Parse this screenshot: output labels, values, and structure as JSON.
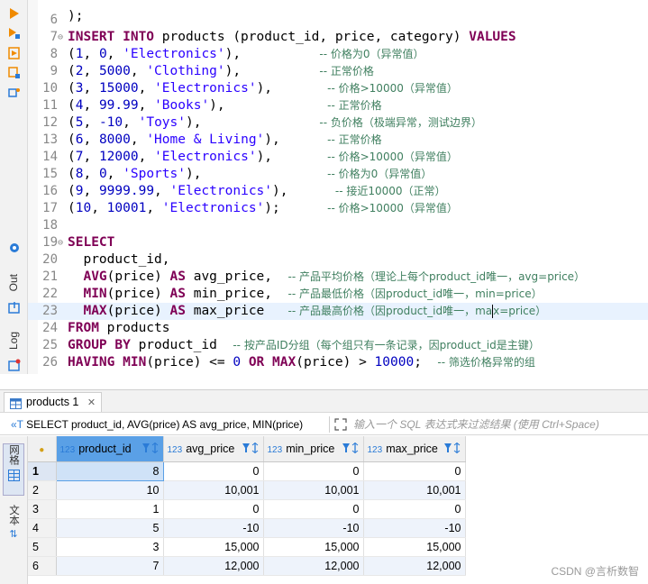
{
  "toolbar": {
    "panel_labels": [
      "Out",
      "Log"
    ]
  },
  "editor": {
    "top_partial_line": ");",
    "lines": [
      {
        "n": "6",
        "html": ""
      },
      {
        "n": "7",
        "fold": "⊖",
        "html": "<span class=\"kw\">INSERT INTO</span> products (product_id, price, category) <span class=\"kw\">VALUES</span>"
      },
      {
        "n": "8",
        "html": "(<span class=\"num\">1</span>, <span class=\"num\">0</span>, <span class=\"str\">'Electronics'</span>),          <span class=\"cmt\">-- 价格为0（异常值）</span>"
      },
      {
        "n": "9",
        "html": "(<span class=\"num\">2</span>, <span class=\"num\">5000</span>, <span class=\"str\">'Clothing'</span>),          <span class=\"cmt\">-- 正常价格</span>"
      },
      {
        "n": "10",
        "html": "(<span class=\"num\">3</span>, <span class=\"num\">15000</span>, <span class=\"str\">'Electronics'</span>),       <span class=\"cmt\">-- 价格&gt;10000（异常值）</span>"
      },
      {
        "n": "11",
        "html": "(<span class=\"num\">4</span>, <span class=\"num\">99.99</span>, <span class=\"str\">'Books'</span>),             <span class=\"cmt\">-- 正常价格</span>"
      },
      {
        "n": "12",
        "html": "(<span class=\"num\">5</span>, <span class=\"num\">-10</span>, <span class=\"str\">'Toys'</span>),               <span class=\"cmt\">-- 负价格（极端异常，测试边界）</span>"
      },
      {
        "n": "13",
        "html": "(<span class=\"num\">6</span>, <span class=\"num\">8000</span>, <span class=\"str\">'Home &amp; Living'</span>),      <span class=\"cmt\">-- 正常价格</span>"
      },
      {
        "n": "14",
        "html": "(<span class=\"num\">7</span>, <span class=\"num\">12000</span>, <span class=\"str\">'Electronics'</span>),       <span class=\"cmt\">-- 价格&gt;10000（异常值）</span>"
      },
      {
        "n": "15",
        "html": "(<span class=\"num\">8</span>, <span class=\"num\">0</span>, <span class=\"str\">'Sports'</span>),                <span class=\"cmt\">-- 价格为0（异常值）</span>"
      },
      {
        "n": "16",
        "html": "(<span class=\"num\">9</span>, <span class=\"num\">9999.99</span>, <span class=\"str\">'Electronics'</span>),      <span class=\"cmt\">-- 接近10000（正常）</span>"
      },
      {
        "n": "17",
        "html": "(<span class=\"num\">10</span>, <span class=\"num\">10001</span>, <span class=\"str\">'Electronics'</span>);      <span class=\"cmt\">-- 价格&gt;10000（异常值）</span>"
      },
      {
        "n": "18",
        "html": ""
      },
      {
        "n": "19",
        "fold": "⊖",
        "html": "<span class=\"kw\">SELECT</span>"
      },
      {
        "n": "20",
        "html": "  product_id,"
      },
      {
        "n": "21",
        "html": "  <span class=\"kw\">AVG</span>(price) <span class=\"kw\">AS</span> avg_price,  <span class=\"cmt\">-- 产品平均价格（理论上每个product_id唯一，avg=price）</span>"
      },
      {
        "n": "22",
        "html": "  <span class=\"kw\">MIN</span>(price) <span class=\"kw\">AS</span> min_price,  <span class=\"cmt\">-- 产品最低价格（因product_id唯一，min=price）</span>"
      },
      {
        "n": "23",
        "current": true,
        "html": "  <span class=\"kw\">MAX</span>(price) <span class=\"kw\">AS</span> max_price   <span class=\"cmt\">-- 产品最高价格（因product_id唯一，ma<span class=\"caret\"></span>x=price）</span>"
      },
      {
        "n": "24",
        "html": "<span class=\"kw\">FROM</span> products"
      },
      {
        "n": "25",
        "html": "<span class=\"kw\">GROUP BY</span> product_id  <span class=\"cmt\">-- 按产品ID分组（每个组只有一条记录，因product_id是主键）</span>"
      },
      {
        "n": "26",
        "html": "<span class=\"kw\">HAVING</span> <span class=\"kw\">MIN</span>(price) &lt;= <span class=\"num\">0</span> <span class=\"kw\">OR</span> <span class=\"kw\">MAX</span>(price) &gt; <span class=\"num\">10000</span>;  <span class=\"cmt\">-- 筛选价格异常的组</span>"
      }
    ]
  },
  "results": {
    "tab_label": "products 1",
    "sql_preview": "SELECT product_id, AVG(price) AS avg_price, MIN(price)",
    "sql_arrow": "«T",
    "filter_placeholder": "输入一个 SQL 表达式来过滤结果 (使用 Ctrl+Space)",
    "side_tabs": [
      "网格",
      "文本"
    ],
    "columns": [
      {
        "type": "123",
        "name": "product_id"
      },
      {
        "type": "123",
        "name": "avg_price"
      },
      {
        "type": "123",
        "name": "min_price"
      },
      {
        "type": "123",
        "name": "max_price"
      }
    ],
    "rows": [
      [
        "1",
        "8",
        "0",
        "0",
        "0"
      ],
      [
        "2",
        "10",
        "10,001",
        "10,001",
        "10,001"
      ],
      [
        "3",
        "1",
        "0",
        "0",
        "0"
      ],
      [
        "4",
        "5",
        "-10",
        "-10",
        "-10"
      ],
      [
        "5",
        "3",
        "15,000",
        "15,000",
        "15,000"
      ],
      [
        "6",
        "7",
        "12,000",
        "12,000",
        "12,000"
      ]
    ]
  },
  "watermark": "CSDN @言析数智",
  "colors": {
    "keyword": "#7f0055",
    "string": "#2a00ff",
    "number": "#0000c0",
    "comment": "#3f7f5f",
    "selection": "#5aa0e6"
  }
}
